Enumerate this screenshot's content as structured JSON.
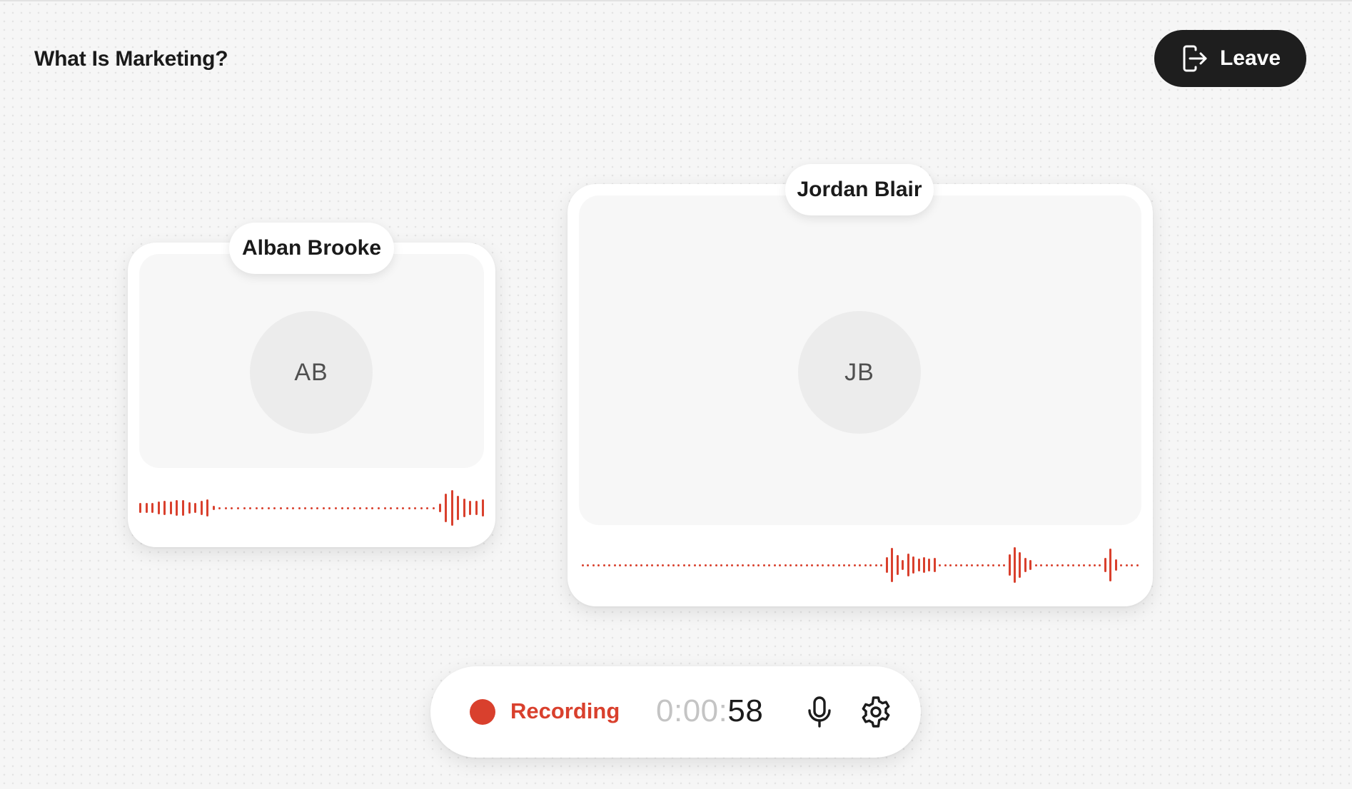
{
  "header": {
    "title": "What Is Marketing?",
    "leave_label": "Leave",
    "leave_icon": "exit-icon"
  },
  "participants": [
    {
      "name": "Alban Brooke",
      "initials": "AB"
    },
    {
      "name": "Jordan Blair",
      "initials": "JB"
    }
  ],
  "controls": {
    "recording_label": "Recording",
    "timer_prefix": "0:00:",
    "timer_seconds": "58",
    "mic_icon": "microphone-icon",
    "settings_icon": "gear-icon"
  },
  "colors": {
    "accent": "#d9402d",
    "dark_button": "#1e1e1e"
  }
}
